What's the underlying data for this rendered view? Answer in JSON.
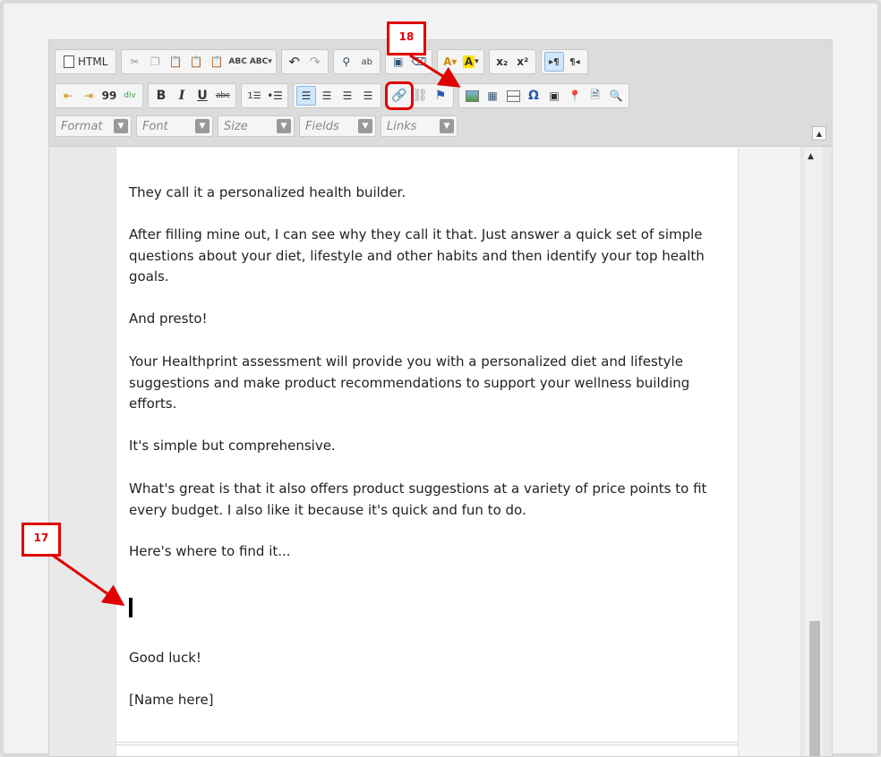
{
  "toolbar": {
    "html_label": "HTML",
    "sub_label": "x₂",
    "sup_label": "x²",
    "bold": "B",
    "italic": "I",
    "underline": "U",
    "strike": "abc",
    "quote": "99",
    "omega": "Ω",
    "format_label": "Format",
    "font_label": "Font",
    "size_label": "Size",
    "fields_label": "Fields",
    "links_label": "Links"
  },
  "content": {
    "p1": "They call it a personalized health builder.",
    "p2": "After filling mine out, I can see why they call it that. Just answer a quick set of simple questions about your diet, lifestyle and other habits and then identify your top health goals.",
    "p3": "And presto!",
    "p4": "Your Healthprint assessment will provide you with a personalized diet and lifestyle suggestions and make product recommendations to support your wellness building efforts.",
    "p5": "It's simple but comprehensive.",
    "p6": "What's great is that it also offers product suggestions at a variety of price points to fit every budget. I also like it because it's quick and fun to do.",
    "p7": "Here's where to find it...",
    "p8": "Good luck!",
    "p9": "[Name here]"
  },
  "annotations": {
    "callout_17": "17",
    "callout_18": "18"
  },
  "colors": {
    "callout": "#e00000",
    "active_button": "#cfe6fb"
  }
}
